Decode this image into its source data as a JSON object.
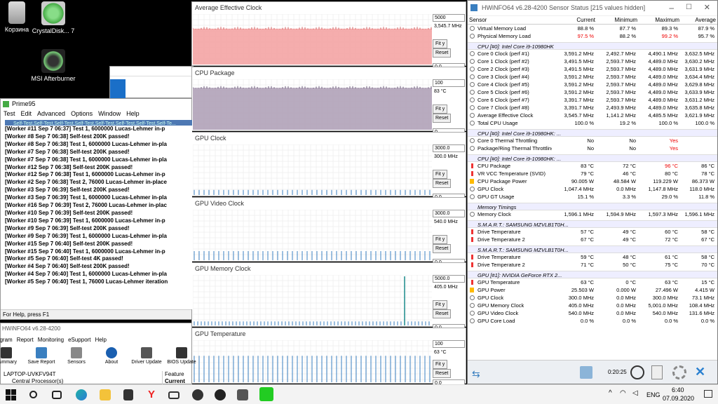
{
  "desktop": {
    "icons": [
      {
        "label": "Корзина"
      },
      {
        "label": "CrystalDisk... 7"
      },
      {
        "label": "MSI Afterburner"
      }
    ]
  },
  "graphs": [
    {
      "title": "Average Effective Clock",
      "max": "5000",
      "current": "3,545.7 MHz",
      "min": "0.0",
      "fit": "Fit y",
      "reset": "Reset",
      "fill": "#f4a4a4",
      "line": "#d06060",
      "level": 0.71
    },
    {
      "title": "CPU Package",
      "max": "100",
      "current": "83 °C",
      "min": "0",
      "fit": "Fit y",
      "reset": "Reset",
      "fill": "#b0a2b8",
      "line": "#6a5a78",
      "level": 0.83
    },
    {
      "title": "GPU Clock",
      "max": "3000.0",
      "current": "300.0 MHz",
      "min": "0.0",
      "fit": "Fit y",
      "reset": "Reset",
      "fill": "#bfe3f0",
      "line": "#3a7fc0",
      "level": 0.1
    },
    {
      "title": "GPU Video Clock",
      "max": "3000.0",
      "current": "540.0 MHz",
      "min": "0.0",
      "fit": "Fit y",
      "reset": "Reset",
      "fill": "#bfe3f0",
      "line": "#3a7fc0",
      "level": 0.18
    },
    {
      "title": "GPU Memory Clock",
      "max": "5000.0",
      "current": "405.0 MHz",
      "min": "0.0",
      "fit": "Fit y",
      "reset": "Reset",
      "fill": "#bfe3f0",
      "line": "#3a7fc0",
      "level": 0.08
    },
    {
      "title": "GPU Temperature",
      "max": "100",
      "current": "63 °C",
      "min": "0.0",
      "fit": "Fit y",
      "reset": "Reset",
      "fill": "#bfe3f0",
      "line": "#3a7fc0",
      "level": 0.63
    }
  ],
  "hwinfo": {
    "title": "HWiNFO64 v6.28-4200 Sensor Status [215 values hidden]",
    "headers": {
      "sensor": "Sensor",
      "current": "Current",
      "min": "Minimum",
      "max": "Maximum",
      "avg": "Average"
    },
    "groups": [
      {
        "title": "",
        "rows": [
          {
            "n": "Virtual Memory Load",
            "c": "88.8 %",
            "mi": "87.7 %",
            "ma": "89.3 %",
            "a": "87.9 %"
          },
          {
            "n": "Physical Memory Load",
            "c": "97.5 %",
            "mi": "88.2 %",
            "ma": "99.2 %",
            "a": "95.7 %",
            "red": true
          }
        ]
      },
      {
        "title": "CPU [#0]: Intel Core i9-10980HK",
        "rows": [
          {
            "n": "Core 0 Clock (perf #1)",
            "c": "3,591.2 MHz",
            "mi": "2,492.7 MHz",
            "ma": "4,490.1 MHz",
            "a": "3,632.5 MHz"
          },
          {
            "n": "Core 1 Clock (perf #2)",
            "c": "3,491.5 MHz",
            "mi": "2,593.7 MHz",
            "ma": "4,489.0 MHz",
            "a": "3,630.2 MHz"
          },
          {
            "n": "Core 2 Clock (perf #3)",
            "c": "3,491.5 MHz",
            "mi": "2,593.7 MHz",
            "ma": "4,489.0 MHz",
            "a": "3,631.9 MHz"
          },
          {
            "n": "Core 3 Clock (perf #4)",
            "c": "3,591.2 MHz",
            "mi": "2,593.7 MHz",
            "ma": "4,489.0 MHz",
            "a": "3,634.4 MHz"
          },
          {
            "n": "Core 4 Clock (perf #5)",
            "c": "3,591.2 MHz",
            "mi": "2,593.7 MHz",
            "ma": "4,489.0 MHz",
            "a": "3,629.8 MHz"
          },
          {
            "n": "Core 5 Clock (perf #6)",
            "c": "3,591.2 MHz",
            "mi": "2,593.7 MHz",
            "ma": "4,489.0 MHz",
            "a": "3,633.9 MHz"
          },
          {
            "n": "Core 6 Clock (perf #7)",
            "c": "3,391.7 MHz",
            "mi": "2,593.7 MHz",
            "ma": "4,489.0 MHz",
            "a": "3,631.2 MHz"
          },
          {
            "n": "Core 7 Clock (perf #8)",
            "c": "3,391.7 MHz",
            "mi": "2,493.9 MHz",
            "ma": "4,489.0 MHz",
            "a": "3,635.8 MHz"
          },
          {
            "n": "Average Effective Clock",
            "c": "3,545.7 MHz",
            "mi": "1,141.2 MHz",
            "ma": "4,485.5 MHz",
            "a": "3,621.9 MHz"
          },
          {
            "n": "Total CPU Usage",
            "c": "100.0 %",
            "mi": "19.2 %",
            "ma": "100.0 %",
            "a": "100.0 %"
          }
        ]
      },
      {
        "title": "CPU [#0]: Intel Core i9-10980HK: ...",
        "rows": [
          {
            "n": "Core 0 Thermal Throttling",
            "c": "No",
            "mi": "No",
            "ma": "Yes",
            "a": "",
            "maRed": true
          },
          {
            "n": "Package/Ring Thermal Throttling",
            "c": "No",
            "mi": "No",
            "ma": "Yes",
            "a": "",
            "maRed": true
          }
        ]
      },
      {
        "title": "CPU [#0]: Intel Core i9-10980HK: ...",
        "rows": [
          {
            "n": "CPU Package",
            "c": "83 °C",
            "mi": "72 °C",
            "ma": "96 °C",
            "a": "86 °C",
            "maRed": true,
            "ic": "t"
          },
          {
            "n": "VR VCC Temperature (SVID)",
            "c": "79 °C",
            "mi": "46 °C",
            "ma": "80 °C",
            "a": "78 °C",
            "ic": "t"
          },
          {
            "n": "CPU Package Power",
            "c": "90.005 W",
            "mi": "48.584 W",
            "ma": "119.229 W",
            "a": "86.373 W",
            "ic": "p"
          },
          {
            "n": "GPU Clock",
            "c": "1,047.4 MHz",
            "mi": "0.0 MHz",
            "ma": "1,147.8 MHz",
            "a": "118.0 MHz"
          },
          {
            "n": "GPU GT Usage",
            "c": "15.1 %",
            "mi": "3.3 %",
            "ma": "29.0 %",
            "a": "11.8 %"
          }
        ]
      },
      {
        "title": "Memory Timings",
        "rows": [
          {
            "n": "Memory Clock",
            "c": "1,596.1 MHz",
            "mi": "1,594.9 MHz",
            "ma": "1,597.3 MHz",
            "a": "1,596.1 MHz"
          }
        ]
      },
      {
        "title": "S.M.A.R.T.: SAMSUNG MZVLB1T0H...",
        "rows": [
          {
            "n": "Drive Temperature",
            "c": "57 °C",
            "mi": "49 °C",
            "ma": "60 °C",
            "a": "58 °C",
            "ic": "t"
          },
          {
            "n": "Drive Temperature 2",
            "c": "67 °C",
            "mi": "49 °C",
            "ma": "72 °C",
            "a": "67 °C",
            "ic": "t"
          }
        ]
      },
      {
        "title": "S.M.A.R.T.: SAMSUNG MZVLB1T0H...",
        "rows": [
          {
            "n": "Drive Temperature",
            "c": "59 °C",
            "mi": "48 °C",
            "ma": "61 °C",
            "a": "58 °C",
            "ic": "t"
          },
          {
            "n": "Drive Temperature 2",
            "c": "71 °C",
            "mi": "50 °C",
            "ma": "75 °C",
            "a": "70 °C",
            "ic": "t"
          }
        ]
      },
      {
        "title": "GPU [#1]: NVIDIA GeForce RTX 2...",
        "rows": [
          {
            "n": "GPU Temperature",
            "c": "63 °C",
            "mi": "0 °C",
            "ma": "63 °C",
            "a": "15 °C",
            "ic": "t"
          },
          {
            "n": "GPU Power",
            "c": "25.503 W",
            "mi": "0.000 W",
            "ma": "27.496 W",
            "a": "4.415 W",
            "ic": "p"
          },
          {
            "n": "GPU Clock",
            "c": "300.0 MHz",
            "mi": "0.0 MHz",
            "ma": "300.0 MHz",
            "a": "73.1 MHz"
          },
          {
            "n": "GPU Memory Clock",
            "c": "405.0 MHz",
            "mi": "0.0 MHz",
            "ma": "5,001.0 MHz",
            "a": "108.4 MHz"
          },
          {
            "n": "GPU Video Clock",
            "c": "540.0 MHz",
            "mi": "0.0 MHz",
            "ma": "540.0 MHz",
            "a": "131.6 MHz"
          },
          {
            "n": "GPU Core Load",
            "c": "0.0 %",
            "mi": "0.0 %",
            "ma": "0.0 %",
            "a": "0.0 %"
          }
        ]
      }
    ],
    "timer": "0:20:25"
  },
  "prime95": {
    "title": "Prime95",
    "menu": [
      "Test",
      "Edit",
      "Advanced",
      "Options",
      "Window",
      "Help"
    ],
    "tab": "Self-Test,Self-Test,Self-Test,Self-Test,Self-Test,Self-Test,Self-Test,Self-Te...",
    "lines": [
      "[Worker #11 Sep 7 06:37] Test 1, 6000000 Lucas-Lehmer in-p",
      "[Worker #8 Sep 7 06:38] Self-test 200K passed!",
      "[Worker #8 Sep 7 06:38] Test 1, 6000000 Lucas-Lehmer in-pla",
      "[Worker #7 Sep 7 06:38] Self-test 200K passed!",
      "[Worker #7 Sep 7 06:38] Test 1, 6000000 Lucas-Lehmer in-pla",
      "[Worker #12 Sep 7 06:38] Self-test 200K passed!",
      "[Worker #12 Sep 7 06:38] Test 1, 6000000 Lucas-Lehmer in-p",
      "[Worker #2 Sep 7 06:38] Test 2, 76000 Lucas-Lehmer in-place",
      "[Worker #3 Sep 7 06:39] Self-test 200K passed!",
      "[Worker #3 Sep 7 06:39] Test 1, 6000000 Lucas-Lehmer in-pla",
      "[Worker #16 Sep 7 06:39] Test 2, 76000 Lucas-Lehmer in-plac",
      "[Worker #10 Sep 7 06:39] Self-test 200K passed!",
      "[Worker #10 Sep 7 06:39] Test 1, 6000000 Lucas-Lehmer in-p",
      "[Worker #9 Sep 7 06:39] Self-test 200K passed!",
      "[Worker #9 Sep 7 06:39] Test 1, 6000000 Lucas-Lehmer in-pla",
      "[Worker #15 Sep 7 06:40] Self-test 200K passed!",
      "[Worker #15 Sep 7 06:40] Test 1, 6000000 Lucas-Lehmer in-p",
      "[Worker #5 Sep 7 06:40] Self-test 4K passed!",
      "[Worker #4 Sep 7 06:40] Self-test 200K passed!",
      "[Worker #4 Sep 7 06:40] Test 1, 6000000 Lucas-Lehmer in-pla",
      "[Worker #5 Sep 7 06:40] Test 1, 76000 Lucas-Lehmer iteration"
    ],
    "status": "For Help, press F1"
  },
  "hwmain": {
    "title": "HWiNFO64 v6.28-4200",
    "menu": [
      "Program",
      "Report",
      "Monitoring",
      "eSupport",
      "Help"
    ],
    "toolbar": [
      "Summary",
      "Save Report",
      "Sensors",
      "About",
      "Driver Update",
      "BIOS Update"
    ],
    "tree_root": "LAPTOP-UVKFV94T",
    "tree_child": "Central Processor(s)",
    "feature": "Feature",
    "current": "Current"
  },
  "taskbar": {
    "lang": "ENG",
    "time": "6:40",
    "date": "07.09.2020"
  }
}
